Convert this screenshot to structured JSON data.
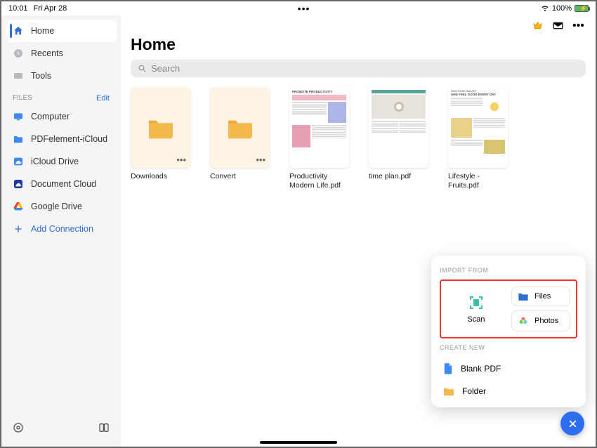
{
  "status": {
    "time": "10:01",
    "date": "Fri Apr 28",
    "battery": "100%"
  },
  "sidebar": {
    "primary": [
      {
        "id": "home",
        "label": "Home"
      },
      {
        "id": "recents",
        "label": "Recents"
      },
      {
        "id": "tools",
        "label": "Tools"
      }
    ],
    "sectionTitle": "FILES",
    "editLabel": "Edit",
    "files": [
      {
        "id": "computer",
        "label": "Computer"
      },
      {
        "id": "pe-icloud",
        "label": "PDFelement-iCloud"
      },
      {
        "id": "icloud",
        "label": "iCloud Drive"
      },
      {
        "id": "doccloud",
        "label": "Document Cloud"
      },
      {
        "id": "gdrive",
        "label": "Google Drive"
      }
    ],
    "addConnection": "Add Connection"
  },
  "main": {
    "title": "Home",
    "searchPlaceholder": "Search",
    "items": [
      {
        "label": "Downloads",
        "type": "folder"
      },
      {
        "label": "Convert",
        "type": "folder"
      },
      {
        "label": "Productivity Modern Life.pdf",
        "type": "doc-prod"
      },
      {
        "label": "time plan.pdf",
        "type": "doc-time"
      },
      {
        "label": "Lifestyle - Fruits.pdf",
        "type": "doc-fruit"
      }
    ]
  },
  "popup": {
    "importTitle": "IMPORT FROM",
    "scan": "Scan",
    "files": "Files",
    "photos": "Photos",
    "createTitle": "CREATE NEW",
    "blank": "Blank PDF",
    "folder": "Folder"
  }
}
